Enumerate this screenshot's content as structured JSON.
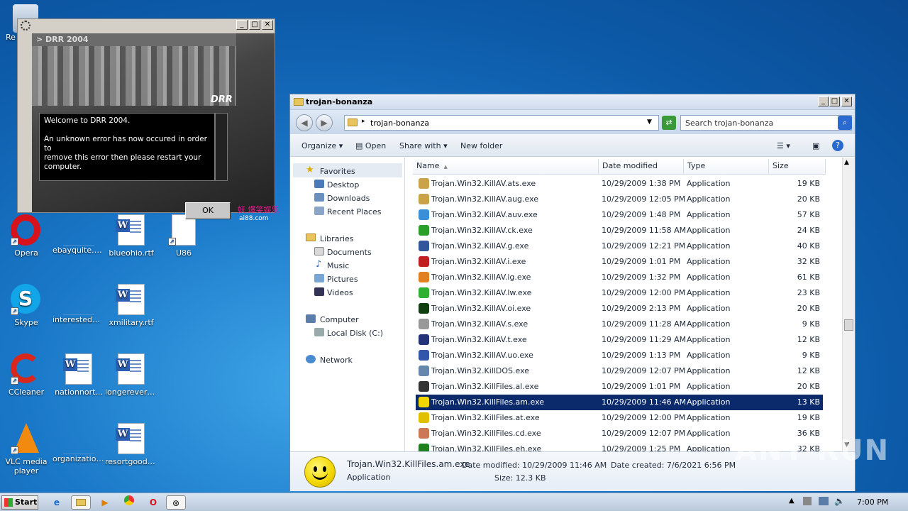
{
  "desktop": {
    "icons": [
      {
        "label": "Re"
      },
      {
        "label": "Opera"
      },
      {
        "label": "ebayquite.png"
      },
      {
        "label": "blueohio.rtf"
      },
      {
        "label": "U86"
      },
      {
        "label": "Skype"
      },
      {
        "label": "interestedm..."
      },
      {
        "label": "xmilitary.rtf"
      },
      {
        "label": "CCleaner"
      },
      {
        "label": "nationnort..."
      },
      {
        "label": "longerevery..."
      },
      {
        "label": "VLC media player"
      },
      {
        "label": "organization..."
      },
      {
        "label": "resortgoods..."
      }
    ]
  },
  "drr": {
    "header": "> DRR 2004",
    "logo": "DRR",
    "message_line1": "Welcome to DRR 2004.",
    "message_line2": "An unknown error has now occured in order to",
    "message_line3": "remove this error then please restart your computer.",
    "ok_label": "OK",
    "side_text": "妖  爆笑娱乐",
    "side_url": "ai88.com"
  },
  "explorer": {
    "title": "trojan-bonanza",
    "address": "trojan-bonanza",
    "search_placeholder": "Search trojan-bonanza",
    "toolbar": {
      "organize": "Organize",
      "open": "Open",
      "share": "Share with",
      "new_folder": "New folder"
    },
    "nav": {
      "favorites": "Favorites",
      "desktop": "Desktop",
      "downloads": "Downloads",
      "recent": "Recent Places",
      "libraries": "Libraries",
      "documents": "Documents",
      "music": "Music",
      "pictures": "Pictures",
      "videos": "Videos",
      "computer": "Computer",
      "local_disk": "Local Disk (C:)",
      "network": "Network"
    },
    "columns": {
      "name": "Name",
      "date": "Date modified",
      "type": "Type",
      "size": "Size"
    },
    "files": [
      {
        "name": "Trojan.Win32.KillAV.ats.exe",
        "date": "10/29/2009 1:38 PM",
        "type": "Application",
        "size": "19 KB",
        "color": "#c9a24a"
      },
      {
        "name": "Trojan.Win32.KillAV.aug.exe",
        "date": "10/29/2009 12:05 PM",
        "type": "Application",
        "size": "20 KB",
        "color": "#c9a24a"
      },
      {
        "name": "Trojan.Win32.KillAV.auv.exe",
        "date": "10/29/2009 1:48 PM",
        "type": "Application",
        "size": "57 KB",
        "color": "#3b8fd6"
      },
      {
        "name": "Trojan.Win32.KillAV.ck.exe",
        "date": "10/29/2009 11:58 AM",
        "type": "Application",
        "size": "24 KB",
        "color": "#2aa02a"
      },
      {
        "name": "Trojan.Win32.KillAV.g.exe",
        "date": "10/29/2009 12:21 PM",
        "type": "Application",
        "size": "40 KB",
        "color": "#335599"
      },
      {
        "name": "Trojan.Win32.KillAV.i.exe",
        "date": "10/29/2009 1:01 PM",
        "type": "Application",
        "size": "32 KB",
        "color": "#c02020"
      },
      {
        "name": "Trojan.Win32.KillAV.ig.exe",
        "date": "10/29/2009 1:32 PM",
        "type": "Application",
        "size": "61 KB",
        "color": "#e08020"
      },
      {
        "name": "Trojan.Win32.KillAV.lw.exe",
        "date": "10/29/2009 12:00 PM",
        "type": "Application",
        "size": "23 KB",
        "color": "#30b030"
      },
      {
        "name": "Trojan.Win32.KillAV.oi.exe",
        "date": "10/29/2009 2:13 PM",
        "type": "Application",
        "size": "20 KB",
        "color": "#104010"
      },
      {
        "name": "Trojan.Win32.KillAV.s.exe",
        "date": "10/29/2009 11:28 AM",
        "type": "Application",
        "size": "9 KB",
        "color": "#999999"
      },
      {
        "name": "Trojan.Win32.KillAV.t.exe",
        "date": "10/29/2009 11:29 AM",
        "type": "Application",
        "size": "12 KB",
        "color": "#223377"
      },
      {
        "name": "Trojan.Win32.KillAV.uo.exe",
        "date": "10/29/2009 1:13 PM",
        "type": "Application",
        "size": "9 KB",
        "color": "#3355aa"
      },
      {
        "name": "Trojan.Win32.KillDOS.exe",
        "date": "10/29/2009 12:07 PM",
        "type": "Application",
        "size": "12 KB",
        "color": "#6688aa"
      },
      {
        "name": "Trojan.Win32.KillFiles.al.exe",
        "date": "10/29/2009 1:01 PM",
        "type": "Application",
        "size": "20 KB",
        "color": "#333333"
      },
      {
        "name": "Trojan.Win32.KillFiles.am.exe",
        "date": "10/29/2009 11:46 AM",
        "type": "Application",
        "size": "13 KB",
        "color": "#f2d600",
        "selected": true
      },
      {
        "name": "Trojan.Win32.KillFiles.at.exe",
        "date": "10/29/2009 12:00 PM",
        "type": "Application",
        "size": "19 KB",
        "color": "#e0c000"
      },
      {
        "name": "Trojan.Win32.KillFiles.cd.exe",
        "date": "10/29/2009 12:07 PM",
        "type": "Application",
        "size": "36 KB",
        "color": "#cc7755"
      },
      {
        "name": "Trojan.Win32.KillFiles.eh.exe",
        "date": "10/29/2009 1:25 PM",
        "type": "Application",
        "size": "32 KB",
        "color": "#208020"
      }
    ],
    "details": {
      "name": "Trojan.Win32.KillFiles.am.exe",
      "type": "Application",
      "modified": "Date modified: 10/29/2009 11:46 AM",
      "size": "Size: 12.3 KB",
      "created": "Date created: 7/6/2021 6:56 PM"
    }
  },
  "taskbar": {
    "start": "Start",
    "clock": "7:00 PM"
  },
  "watermark": "ANY RUN"
}
